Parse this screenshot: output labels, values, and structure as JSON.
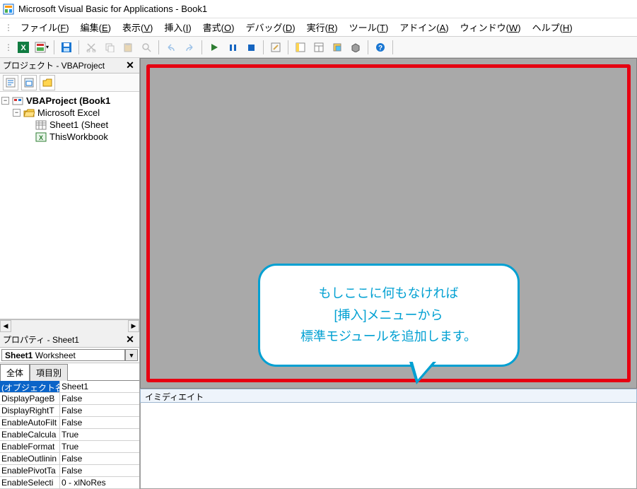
{
  "window": {
    "title": "Microsoft Visual Basic for Applications - Book1"
  },
  "menu": {
    "file": "ファイル(",
    "file_u": "F",
    "file_e": ")",
    "edit": "編集(",
    "edit_u": "E",
    "view": "表示(",
    "view_u": "V",
    "insert": "挿入(",
    "insert_u": "I",
    "format": "書式(",
    "format_u": "O",
    "debug": "デバッグ(",
    "debug_u": "D",
    "run": "実行(",
    "run_u": "R",
    "tools": "ツール(",
    "tools_u": "T",
    "addin": "アドイン(",
    "addin_u": "A",
    "window": "ウィンドウ(",
    "window_u": "W",
    "help": "ヘルプ(",
    "help_u": "H"
  },
  "project_panel": {
    "title": "プロジェクト - VBAProject",
    "root": "VBAProject (Book1",
    "excel_folder": "Microsoft Excel",
    "sheet1": "Sheet1 (Sheet",
    "thisworkbook": "ThisWorkbook"
  },
  "properties_panel": {
    "title": "プロパティ - Sheet1",
    "object_name": "Sheet1",
    "object_type": "Worksheet",
    "tab_all": "全体",
    "tab_cat": "項目別",
    "rows": [
      {
        "name": "(オブジェクト名)",
        "val": "Sheet1"
      },
      {
        "name": "DisplayPageB",
        "val": "False"
      },
      {
        "name": "DisplayRightT",
        "val": "False"
      },
      {
        "name": "EnableAutoFilt",
        "val": "False"
      },
      {
        "name": "EnableCalcula",
        "val": "True"
      },
      {
        "name": "EnableFormat",
        "val": "True"
      },
      {
        "name": "EnableOutlinin",
        "val": "False"
      },
      {
        "name": "EnablePivotTa",
        "val": "False"
      },
      {
        "name": "EnableSelecti",
        "val": "0 - xlNoRes"
      }
    ]
  },
  "speech": {
    "line1": "もしここに何もなければ",
    "line2": "[挿入]メニューから",
    "line3": "標準モジュールを追加します。"
  },
  "immediate": {
    "title": "イミディエイト"
  }
}
